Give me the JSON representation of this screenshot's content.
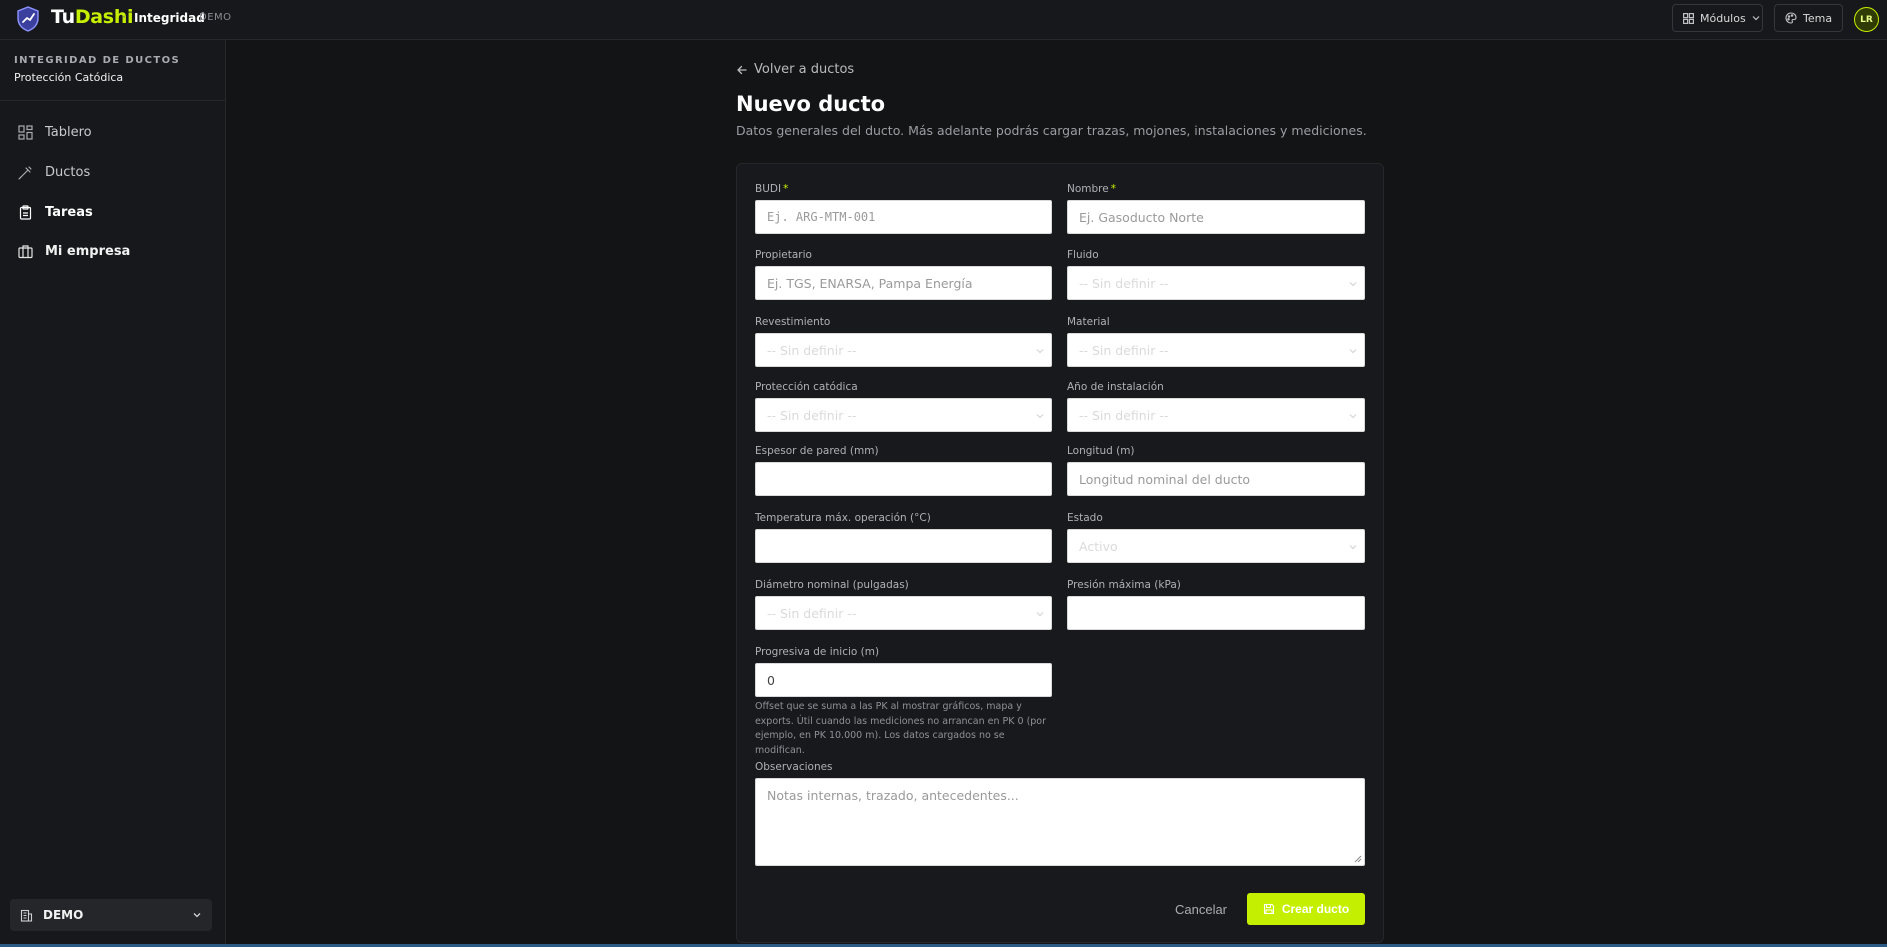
{
  "topbar": {
    "brand_tu": "Tu",
    "brand_dashi": "Dashi",
    "separator": "·",
    "module": "Integridad",
    "env_badge": "DEMO",
    "modules_button": "Módulos",
    "theme_button": "Tema",
    "avatar_initials": "LR"
  },
  "sidebar": {
    "section_title": "INTEGRIDAD DE DUCTOS",
    "section_subtitle": "Protección Catódica",
    "items": [
      {
        "label": "Tablero",
        "icon": "dashboard-icon"
      },
      {
        "label": "Ductos",
        "icon": "pipe-icon"
      },
      {
        "label": "Tareas",
        "icon": "clipboard-icon"
      },
      {
        "label": "Mi empresa",
        "icon": "briefcase-icon"
      }
    ],
    "company": "DEMO"
  },
  "main": {
    "back_link": "Volver a ductos",
    "title": "Nuevo ducto",
    "subtitle": "Datos generales del ducto. Más adelante podrás cargar trazas, mojones, instalaciones y mediciones.",
    "form": {
      "budi": {
        "label": "BUDI",
        "required_mark": "*",
        "placeholder": "Ej. ARG-MTM-001"
      },
      "nombre": {
        "label": "Nombre",
        "required_mark": "*",
        "placeholder": "Ej. Gasoducto Norte"
      },
      "propietario": {
        "label": "Propietario",
        "placeholder": "Ej. TGS, ENARSA, Pampa Energía"
      },
      "fluido": {
        "label": "Fluido",
        "value": "-- Sin definir --"
      },
      "revestimiento": {
        "label": "Revestimiento",
        "value": "-- Sin definir --"
      },
      "material": {
        "label": "Material",
        "value": "-- Sin definir --"
      },
      "proteccion": {
        "label": "Protección catódica",
        "value": "-- Sin definir --"
      },
      "anio": {
        "label": "Año de instalación",
        "value": "-- Sin definir --"
      },
      "espesor": {
        "label": "Espesor de pared (mm)",
        "value": ""
      },
      "longitud": {
        "label": "Longitud (m)",
        "placeholder": "Longitud nominal del ducto"
      },
      "temperatura": {
        "label": "Temperatura máx. operación (°C)",
        "value": ""
      },
      "estado": {
        "label": "Estado",
        "value": "Activo"
      },
      "diametro": {
        "label": "Diámetro nominal (pulgadas)",
        "value": "-- Sin definir --"
      },
      "presion": {
        "label": "Presión máxima (kPa)",
        "value": ""
      },
      "progresiva": {
        "label": "Progresiva de inicio (m)",
        "value": "0",
        "help": "Offset que se suma a las PK al mostrar gráficos, mapa y exports. Útil cuando las mediciones no arrancan en PK 0 (por ejemplo, en PK 10.000 m). Los datos cargados no se modifican."
      },
      "observaciones": {
        "label": "Observaciones",
        "placeholder": "Notas internas, trazado, antecedentes..."
      },
      "cancel_label": "Cancelar",
      "create_label": "Crear ducto"
    }
  },
  "colors": {
    "accent": "#c4f000",
    "background": "#131416",
    "panel": "#17181b"
  }
}
